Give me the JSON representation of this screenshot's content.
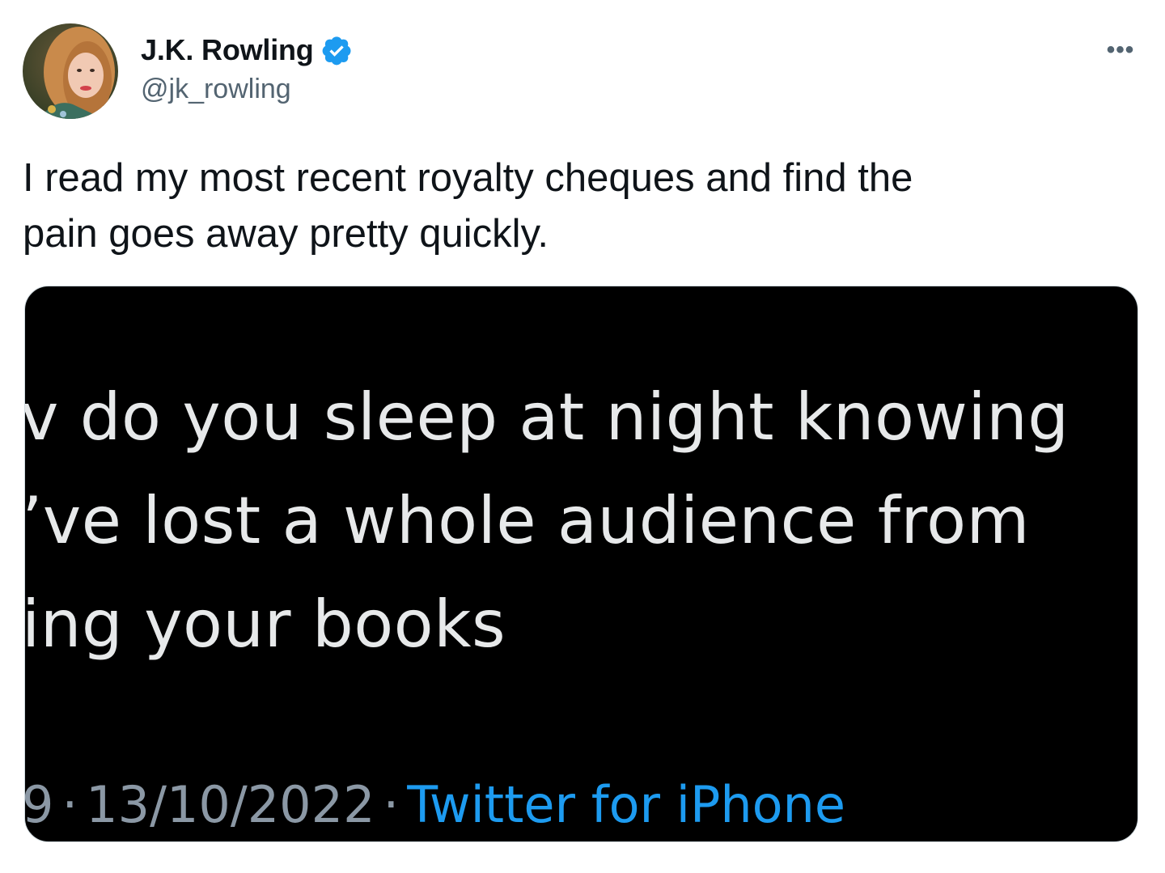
{
  "author": {
    "display_name": "J.K. Rowling",
    "handle": "@jk_rowling",
    "verified": true,
    "avatar_icon": "profile-photo"
  },
  "more_button": "•••",
  "tweet": {
    "text_lines": [
      "I read my most recent royalty cheques and find the",
      "pain goes away pretty quickly."
    ]
  },
  "media": {
    "quoted_lines": [
      "v do you sleep at night knowing",
      "’ve lost a whole audience from",
      "ing your books"
    ],
    "meta": {
      "time_fragment": "9",
      "date": "13/10/2022",
      "separator": "·",
      "source": "Twitter for iPhone"
    }
  },
  "colors": {
    "text_primary": "#0f1419",
    "text_secondary": "#536471",
    "verified_blue": "#1d9bf0",
    "media_background": "#000000",
    "media_text": "#e7e9ea",
    "media_meta": "#8b98a5"
  }
}
